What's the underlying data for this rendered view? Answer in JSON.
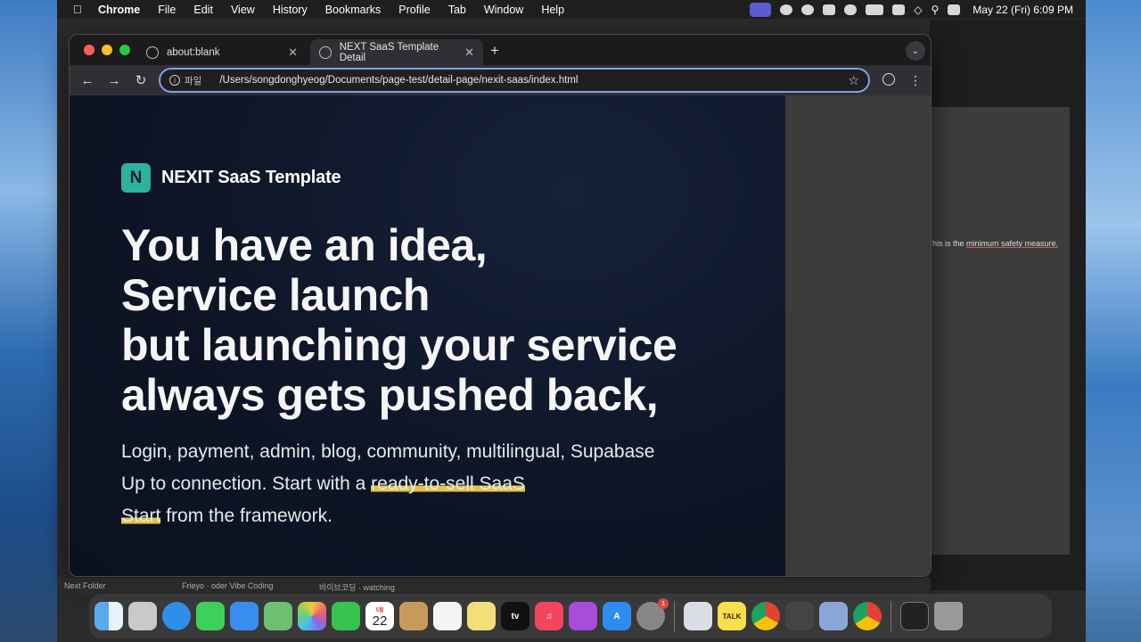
{
  "menubar": {
    "app": "Chrome",
    "items": [
      "File",
      "Edit",
      "View",
      "History",
      "Bookmarks",
      "Profile",
      "Tab",
      "Window",
      "Help"
    ],
    "clock": "May 22 (Fri)  6:09 PM",
    "tray_icons": [
      "screen-record-icon",
      "media-icon",
      "record-icon",
      "shield-icon",
      "toggle-icon",
      "battery-icon",
      "input-method-icon",
      "wifi-icon",
      "search-icon",
      "control-center-icon"
    ]
  },
  "browser": {
    "tabs": [
      {
        "label": "about:blank",
        "active": false
      },
      {
        "label": "NEXT SaaS Template Detail",
        "active": true
      }
    ],
    "omnibox": {
      "chip": "파일",
      "url": "/Users/songdonghyeog/Documents/page-test/detail-page/nexit-saas/index.html"
    }
  },
  "page": {
    "logo_letter": "N",
    "brand_name": "NEXIT SaaS Template",
    "headline": [
      "You have an idea,",
      "Service launch",
      "but launching your service",
      "always gets pushed back,"
    ],
    "sub": {
      "line1": "Login, payment, admin, blog, community, multilingual, Supabase",
      "line2_pre": "Up to connection. Start with a ",
      "line2_hl": "ready-to-sell SaaS",
      "line3_hl": "Start",
      "line3_post": " from the framework."
    }
  },
  "background_window": {
    "text_pre": "his is the ",
    "text_link": "minimum safety measure."
  },
  "below_window": {
    "left": "Next Folder",
    "mid1": "Frieyo · oder Vibe Coding",
    "mid2": "바이브코딩 · watching"
  },
  "dock": {
    "apps": [
      "Finder",
      "Launchpad",
      "Safari",
      "Messages",
      "Mail",
      "Maps",
      "Photos",
      "FaceTime",
      "Calendar",
      "Notes",
      "Reminders",
      "Stickies",
      "TV",
      "Music",
      "Podcasts",
      "App Store",
      "System Settings",
      "Xcode",
      "KakaoTalk",
      "Chrome",
      "Box",
      "Preview",
      "Chrome Canary",
      "Terminal",
      "Trash"
    ],
    "calendar_day": "22",
    "calendar_month": "5월",
    "kakaotalk_label": "TALK",
    "tv_label": "tv",
    "settings_badge": "1"
  }
}
